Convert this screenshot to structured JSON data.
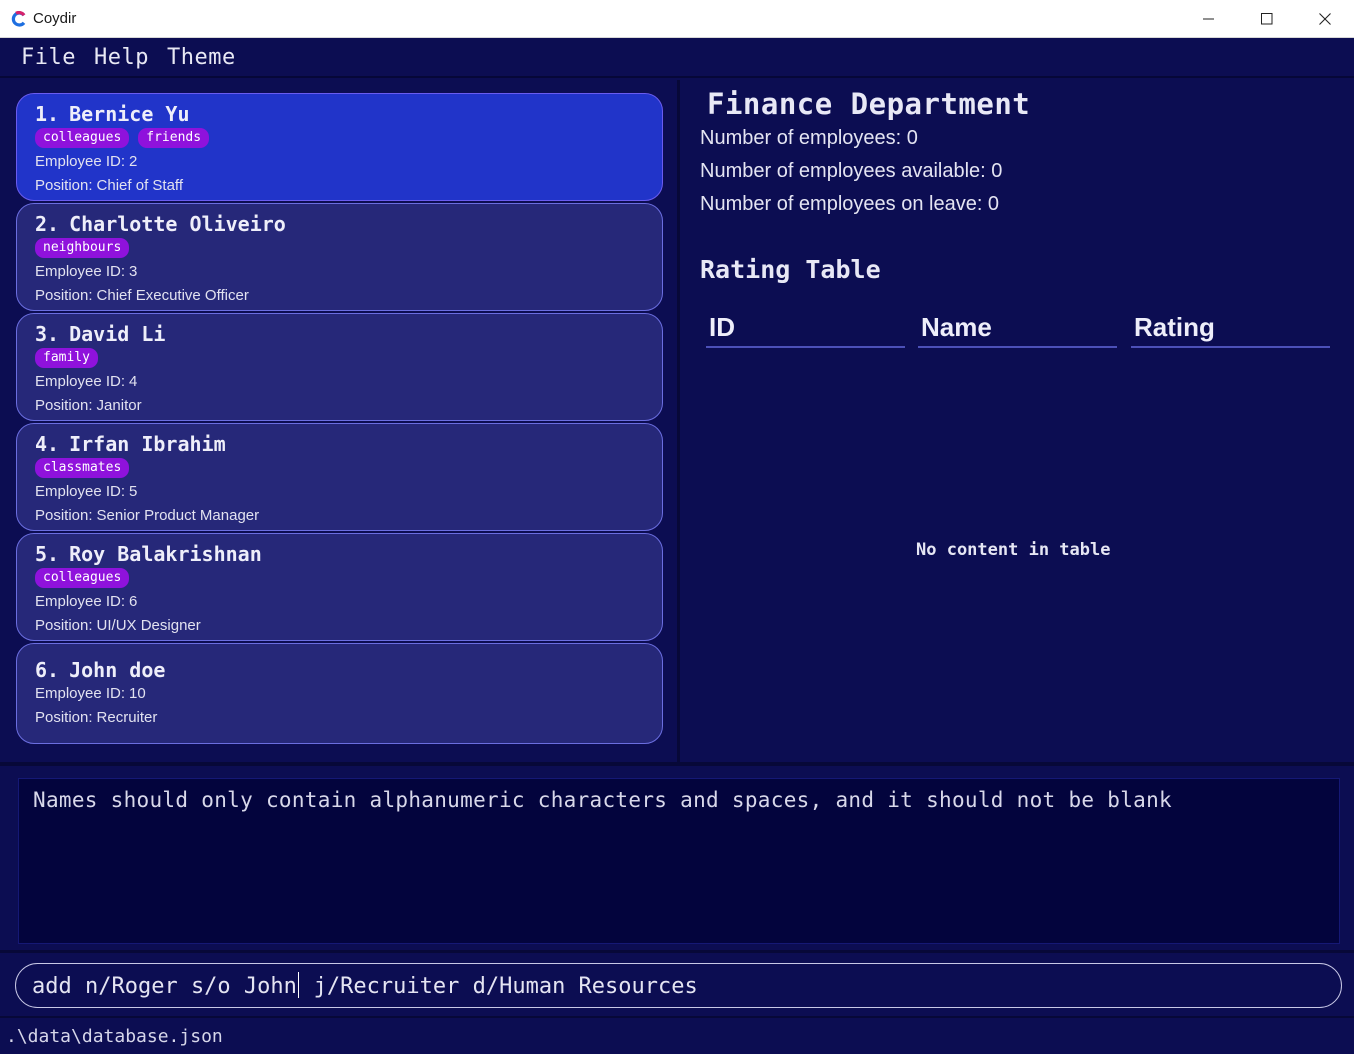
{
  "window": {
    "title": "Coydir",
    "logo_icon": "coydir-logo-icon",
    "controls": [
      "minimize-icon",
      "maximize-icon",
      "close-icon"
    ]
  },
  "menu": {
    "items": [
      {
        "label": "File"
      },
      {
        "label": "Help"
      },
      {
        "label": "Theme"
      }
    ]
  },
  "employees": [
    {
      "index": "1.",
      "name": "Bernice Yu",
      "tags": [
        "colleagues",
        "friends"
      ],
      "id_label": "Employee ID:",
      "id": "2",
      "position_label": "Position:",
      "position": "Chief of Staff",
      "selected": true
    },
    {
      "index": "2.",
      "name": "Charlotte Oliveiro",
      "tags": [
        "neighbours"
      ],
      "id_label": "Employee ID:",
      "id": "3",
      "position_label": "Position:",
      "position": "Chief Executive Officer",
      "selected": false
    },
    {
      "index": "3.",
      "name": "David Li",
      "tags": [
        "family"
      ],
      "id_label": "Employee ID:",
      "id": "4",
      "position_label": "Position:",
      "position": "Janitor",
      "selected": false
    },
    {
      "index": "4.",
      "name": "Irfan Ibrahim",
      "tags": [
        "classmates"
      ],
      "id_label": "Employee ID:",
      "id": "5",
      "position_label": "Position:",
      "position": "Senior Product Manager",
      "selected": false
    },
    {
      "index": "5.",
      "name": "Roy Balakrishnan",
      "tags": [
        "colleagues"
      ],
      "id_label": "Employee ID:",
      "id": "6",
      "position_label": "Position:",
      "position": "UI/UX Designer",
      "selected": false
    },
    {
      "index": "6.",
      "name": "John doe",
      "tags": [],
      "id_label": "Employee ID:",
      "id": "10",
      "position_label": "Position:",
      "position": "Recruiter",
      "selected": false
    }
  ],
  "department": {
    "title": "Finance Department",
    "stats": [
      "Number of employees: 0",
      "Number of employees available: 0",
      "Number of employees on leave: 0"
    ],
    "rating_title": "Rating Table",
    "columns": [
      "ID",
      "Name",
      "Rating"
    ],
    "empty_message": "No content in table"
  },
  "result": {
    "text": "Names should only contain alphanumeric characters and spaces, and it should not be blank"
  },
  "command": {
    "before_caret": "add n/Roger s/o John",
    "after_caret": " j/Recruiter d/Human Resources"
  },
  "status": {
    "path": ".\\data\\database.json"
  },
  "colors": {
    "background": "#0c0d52",
    "card": "#262879",
    "card_selected": "#2134c9",
    "tag": "#8f12dc",
    "result_box": "#03043d"
  }
}
